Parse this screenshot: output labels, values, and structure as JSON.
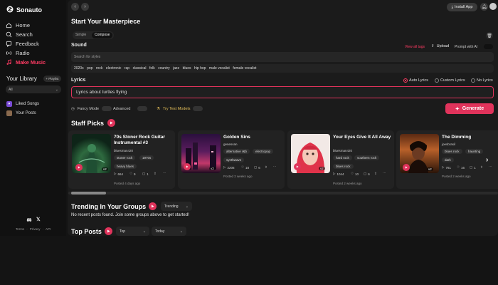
{
  "app": {
    "name": "Sonauto"
  },
  "sidebar": {
    "nav": [
      {
        "label": "Home",
        "icon": "home-icon"
      },
      {
        "label": "Search",
        "icon": "search-icon"
      },
      {
        "label": "Feedback",
        "icon": "feedback-icon"
      },
      {
        "label": "Radio",
        "icon": "radio-icon"
      },
      {
        "label": "Make Music",
        "icon": "music-note-icon"
      }
    ],
    "library": {
      "title": "Your Library",
      "playlist_button": "+ Playlist",
      "filter_value": "All",
      "items": [
        {
          "label": "Liked Songs"
        },
        {
          "label": "Your Posts"
        }
      ]
    },
    "footer_links": [
      "Terms",
      "·",
      "Privacy",
      "·",
      "API"
    ]
  },
  "header": {
    "install_label": "Install App"
  },
  "compose": {
    "title": "Start Your Masterpiece",
    "tabs": [
      "Simple",
      "Compose"
    ],
    "sound_label": "Sound",
    "view_all_tags": "View all tags",
    "upload_label": "Upload",
    "prompt_ai_label": "Prompt with AI",
    "style_placeholder": "Search for styles",
    "tags": [
      "2020s",
      "pop",
      "rock",
      "electronic",
      "rap",
      "classical",
      "folk",
      "country",
      "jazz",
      "blues",
      "hip hop",
      "male vocalist",
      "female vocalist"
    ],
    "lyrics_label": "Lyrics",
    "lyrics_options": [
      "Auto Lyrics",
      "Custom Lyrics",
      "No Lyrics"
    ],
    "lyrics_value": "Lyrics about turtles flying",
    "toggles": [
      "Fancy Mode",
      "Advanced",
      "Try Test Models"
    ],
    "generate_label": "Generate"
  },
  "staff_picks": {
    "title": "Staff Picks",
    "cards": [
      {
        "title": "70s Stoner Rock Guitar Instrumental #3",
        "user": "bluesman420",
        "tags": [
          "stoner rock",
          "1970s",
          "heavy blues"
        ],
        "plays": "664",
        "likes": "9",
        "comments": "1",
        "posted": "Posted 4 days ago"
      },
      {
        "title": "Golden Sins",
        "user": "genesvan",
        "tags": [
          "alternative r&b",
          "electropop",
          "synthwave"
        ],
        "plays": "2206",
        "likes": "18",
        "comments": "6",
        "posted": "Posted 2 weeks ago"
      },
      {
        "title": "Your Eyes Give It All Away",
        "user": "bluesman420",
        "tags": [
          "hard rock",
          "southern rock",
          "blues rock"
        ],
        "plays": "1044",
        "likes": "10",
        "comments": "6",
        "posted": "Posted 2 weeks ago"
      },
      {
        "title": "The Dimming",
        "user": "joesbrasil",
        "tags": [
          "blues rock",
          "haunting",
          "dark"
        ],
        "plays": "761",
        "likes": "16",
        "comments": "1",
        "posted": "Posted 2 weeks ago"
      }
    ],
    "version_badge": "v2"
  },
  "trending": {
    "title": "Trending In Your Groups",
    "filter": "Trending",
    "empty_message": "No recent posts found. Join some groups above to get started!"
  },
  "top_posts": {
    "title": "Top Posts",
    "filter_1": "Top",
    "filter_2": "Today"
  },
  "colors": {
    "accent": "#e0335b",
    "background": "#141414",
    "panel": "#1b1b1b"
  }
}
